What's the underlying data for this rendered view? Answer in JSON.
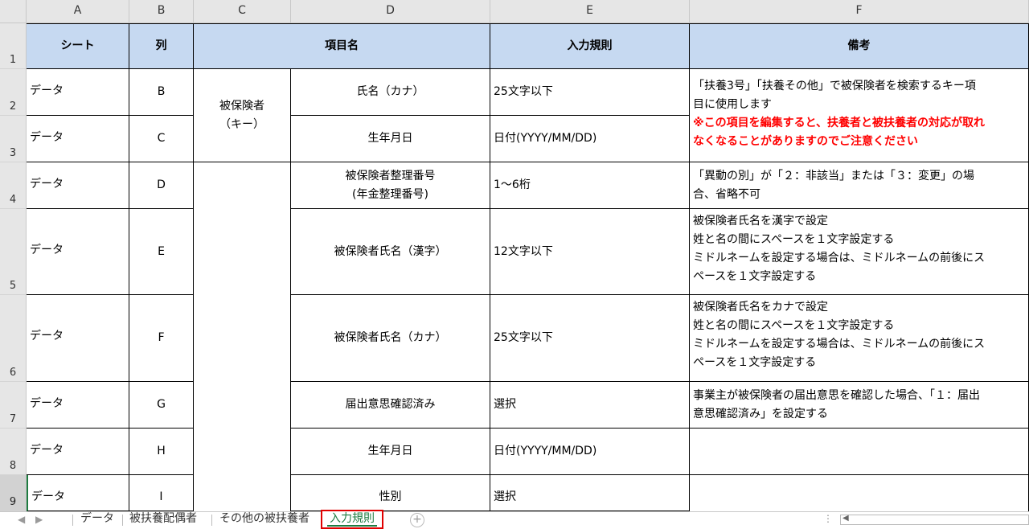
{
  "columns": [
    "A",
    "B",
    "C",
    "D",
    "E",
    "F"
  ],
  "rows": [
    "1",
    "2",
    "3",
    "4",
    "5",
    "6",
    "7",
    "8",
    "9"
  ],
  "header": {
    "sheet": "シート",
    "col": "列",
    "item": "項目名",
    "rule": "入力規則",
    "note": "備考"
  },
  "data_rows": [
    {
      "sheet": "データ",
      "col": "B",
      "item": "氏名（カナ）",
      "rule": "25文字以下"
    },
    {
      "sheet": "データ",
      "col": "C",
      "item": "生年月日",
      "rule": "日付(YYYY/MM/DD)"
    },
    {
      "sheet": "データ",
      "col": "D",
      "item_line1": "被保険者整理番号",
      "item_line2": "(年金整理番号)",
      "rule": "1～6桁"
    },
    {
      "sheet": "データ",
      "col": "E",
      "item": "被保険者氏名（漢字）",
      "rule": "12文字以下"
    },
    {
      "sheet": "データ",
      "col": "F",
      "item": "被保険者氏名（カナ）",
      "rule": "25文字以下"
    },
    {
      "sheet": "データ",
      "col": "G",
      "item": "届出意思確認済み",
      "rule": "選択"
    },
    {
      "sheet": "データ",
      "col": "H",
      "item": "生年月日",
      "rule": "日付(YYYY/MM/DD)"
    },
    {
      "sheet": "データ",
      "col": "I",
      "item": "性別",
      "rule": "選択"
    }
  ],
  "key_group": {
    "line1": "被保険者",
    "line2": "（キー）"
  },
  "notes": {
    "r23_line1": "「扶養3号」「扶養その他」で被保険者を検索するキー項",
    "r23_line2": "目に使用します",
    "r23_warn1": "※この項目を編集すると、扶養者と被扶養者の対応が取れ",
    "r23_warn2": "なくなることがありますのでご注意ください",
    "r4_line1": "「異動の別」が「２：非該当」または「３：変更」の場",
    "r4_line2": "合、省略不可",
    "r5_line1": "被保険者氏名を漢字で設定",
    "r5_line2": "姓と名の間にスペースを１文字設定する",
    "r5_line3": "ミドルネームを設定する場合は、ミドルネームの前後にス",
    "r5_line4": "ペースを１文字設定する",
    "r6_line1": "被保険者氏名をカナで設定",
    "r6_line2": "姓と名の間にスペースを１文字設定する",
    "r6_line3": "ミドルネームを設定する場合は、ミドルネームの前後にス",
    "r6_line4": "ペースを１文字設定する",
    "r7_line1": "事業主が被保険者の届出意思を確認した場合、「１：届出",
    "r7_line2": "意思確認済み」を設定する"
  },
  "tabs": [
    "データ",
    "被扶養配偶者",
    "その他の被扶養者",
    "入力規則"
  ],
  "active_tab": "入力規則",
  "colors": {
    "header_fill": "#c6d9f1",
    "warning": "#ff0000",
    "active_tab_text": "#1e7b40",
    "highlight_box": "#e00000"
  }
}
